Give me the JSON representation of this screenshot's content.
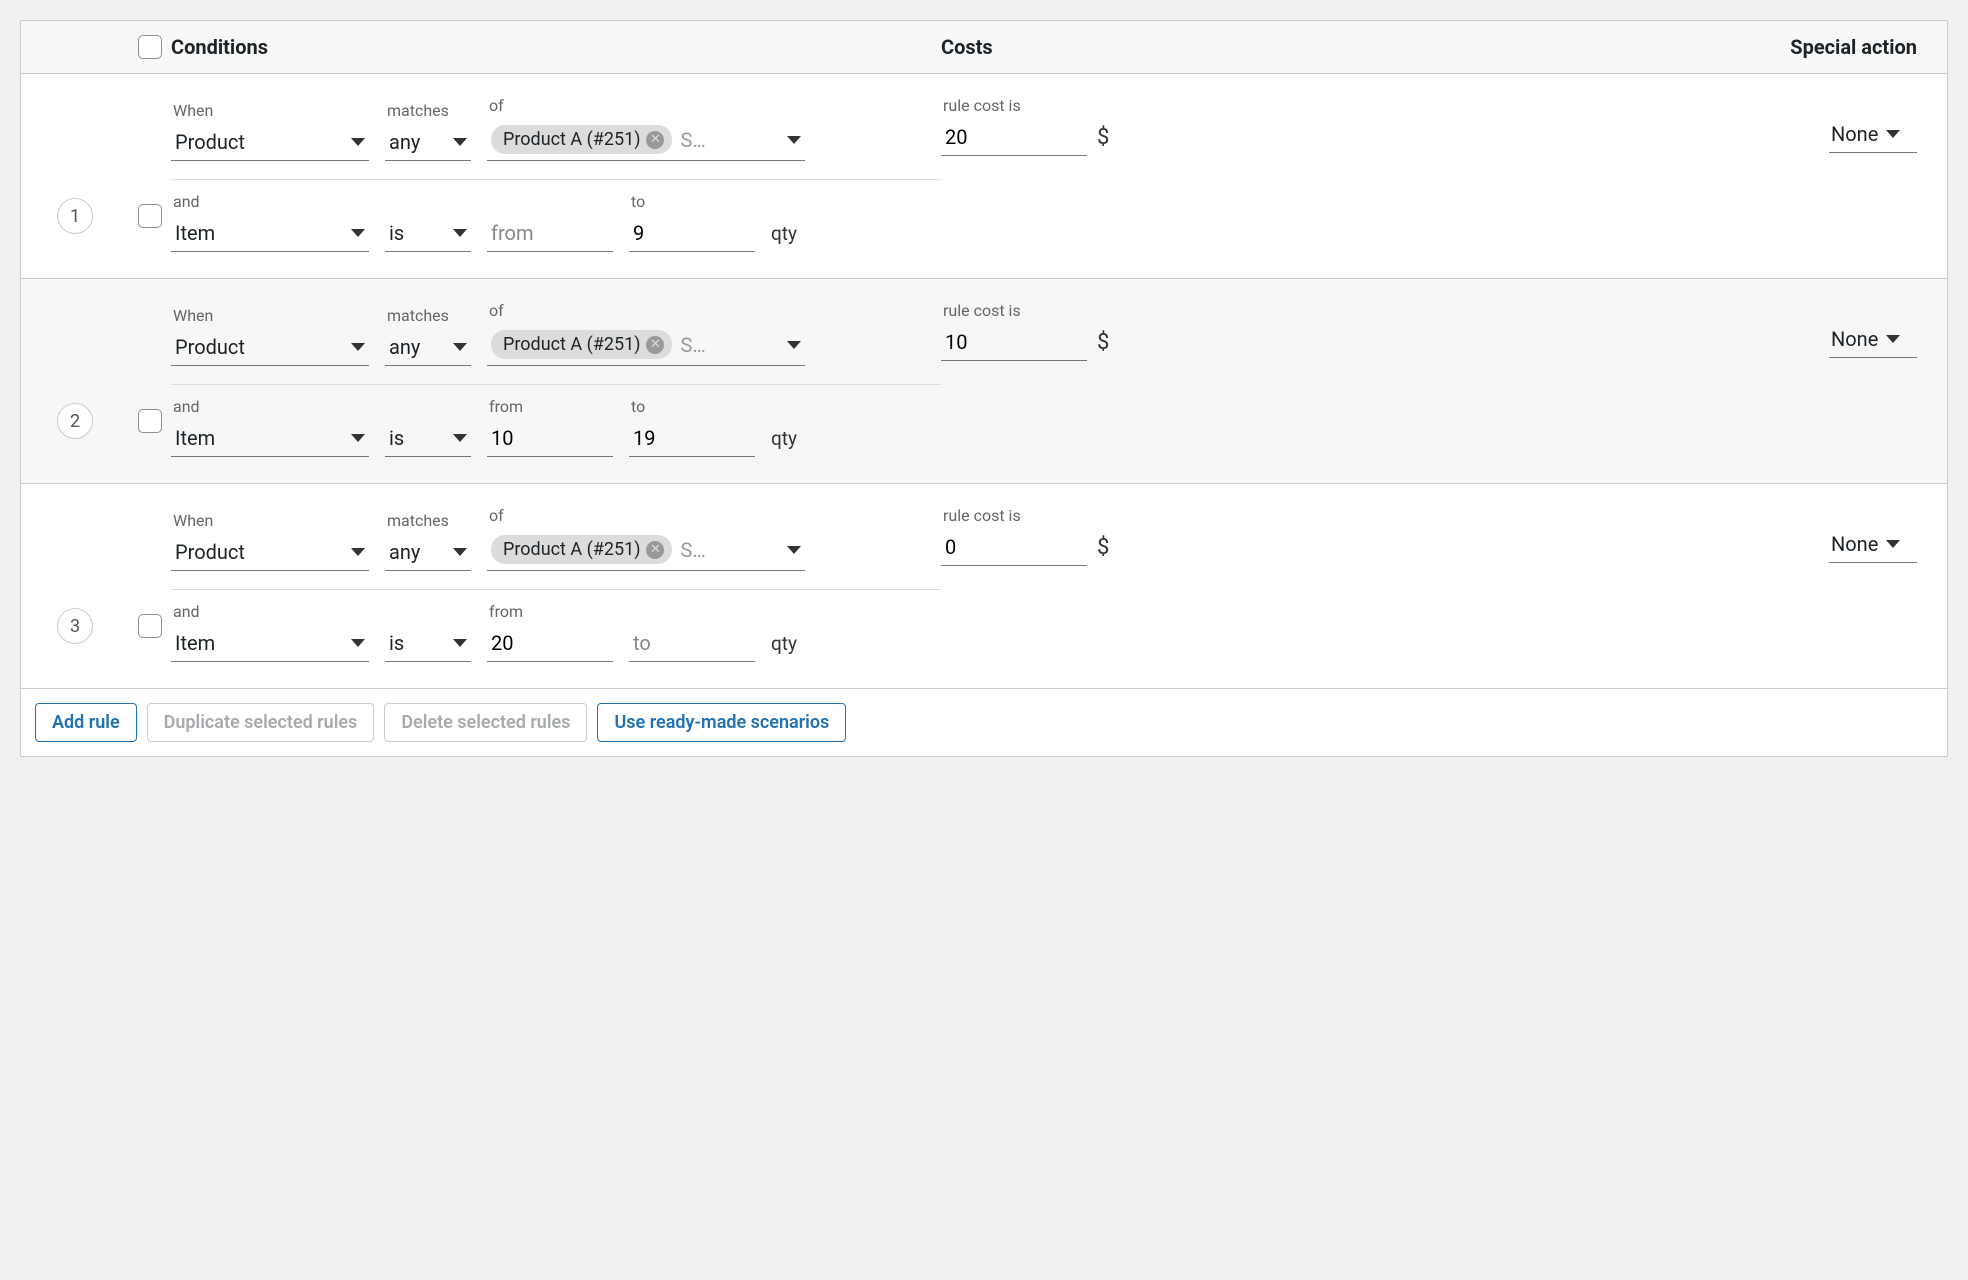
{
  "header": {
    "conditions": "Conditions",
    "costs": "Costs",
    "special_action": "Special action"
  },
  "labels": {
    "when": "When",
    "matches": "matches",
    "of": "of",
    "and": "and",
    "from": "from",
    "to": "to",
    "qty": "qty",
    "rule_cost_is": "rule cost is",
    "currency": "$",
    "search_placeholder": "S…",
    "from_placeholder": "from",
    "to_placeholder": "to"
  },
  "rules": [
    {
      "index": "1",
      "when": "Product",
      "matches": "any",
      "chip": "Product A (#251)",
      "and": "Item",
      "is": "is",
      "from": "",
      "to": "9",
      "cost": "20",
      "action": "None"
    },
    {
      "index": "2",
      "when": "Product",
      "matches": "any",
      "chip": "Product A (#251)",
      "and": "Item",
      "is": "is",
      "from": "10",
      "to": "19",
      "cost": "10",
      "action": "None"
    },
    {
      "index": "3",
      "when": "Product",
      "matches": "any",
      "chip": "Product A (#251)",
      "and": "Item",
      "is": "is",
      "from": "20",
      "to": "",
      "cost": "0",
      "action": "None"
    }
  ],
  "footer": {
    "add_rule": "Add rule",
    "duplicate": "Duplicate selected rules",
    "delete": "Delete selected rules",
    "scenarios": "Use ready-made scenarios"
  }
}
